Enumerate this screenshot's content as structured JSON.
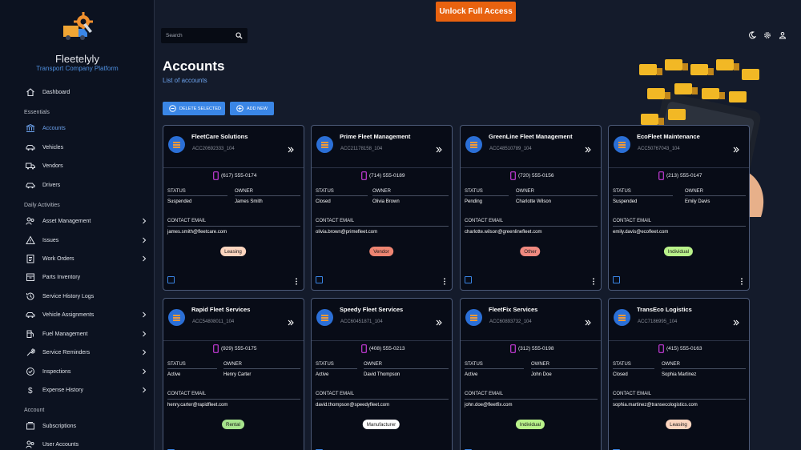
{
  "app": {
    "name": "Fleetelyly",
    "tagline": "Transport Company Platform"
  },
  "topbar": {
    "unlock_label": "Unlock Full Access",
    "search_placeholder": "Search"
  },
  "icons": {
    "theme": "moon-icon",
    "settings": "gear-icon",
    "profile": "person-icon"
  },
  "colors": {
    "accent": "#3a86e6",
    "unlock": "#e8620f",
    "sidebar_bg": "#0c1220",
    "page_bg": "#141b2b"
  },
  "sidebar": {
    "dashboard": "Dashboard",
    "sections": {
      "essentials": "Essentials",
      "daily": "Daily Activities",
      "account": "Account"
    },
    "essentials": [
      "Accounts",
      "Vehicles",
      "Vendors",
      "Drivers"
    ],
    "daily": [
      "Asset Management",
      "Issues",
      "Work Orders",
      "Parts Inventory",
      "Service History Logs",
      "Vehicle Assignments",
      "Fuel Management",
      "Service Reminders",
      "Inspections",
      "Expense History"
    ],
    "account": [
      "Subscriptions",
      "User Accounts"
    ],
    "active": "Accounts"
  },
  "page": {
    "title": "Accounts",
    "subtitle": "List of accounts",
    "delete_label": "DELETE SELECTED",
    "add_label": "ADD NEW"
  },
  "field_labels": {
    "status": "STATUS",
    "owner": "OWNER",
    "email": "CONTACT EMAIL"
  },
  "cards": [
    {
      "name": "FleetCare Solutions",
      "account": "ACC20692333_104",
      "phone": "(617) 555-0174",
      "status": "Suspended",
      "owner": "James Smith",
      "email": "james.smith@fleetcare.com",
      "type": "Leasing",
      "badge_color": "#fcd5bf"
    },
    {
      "name": "Prime Fleet Management",
      "account": "ACC21178158_104",
      "phone": "(714) 555-0189",
      "status": "Closed",
      "owner": "Olivia Brown",
      "email": "olivia.brown@primefleet.com",
      "type": "Vendor",
      "badge_color": "#ee8572"
    },
    {
      "name": "GreenLine Fleet Management",
      "account": "ACC48510789_104",
      "phone": "(720) 555-0156",
      "status": "Pending",
      "owner": "Charlotte Wilson",
      "email": "charlotte.wilson@greenlinefleet.com",
      "type": "Other",
      "badge_color": "#f08a80"
    },
    {
      "name": "EcoFleet Maintenance",
      "account": "ACC50767043_104",
      "phone": "(213) 555-0147",
      "status": "Suspended",
      "owner": "Emily Davis",
      "email": "emily.davis@ecofleet.com",
      "type": "Individual",
      "badge_color": "#b9f28a"
    },
    {
      "name": "Rapid Fleet Services",
      "account": "ACC54808011_104",
      "phone": "(929) 555-0175",
      "status": "Active",
      "owner": "Henry Carter",
      "email": "henry.carter@rapidfleet.com",
      "type": "Rental",
      "badge_color": "#a7e48d"
    },
    {
      "name": "Speedy Fleet Services",
      "account": "ACC60451871_104",
      "phone": "(408) 555-0213",
      "status": "Active",
      "owner": "David Thompson",
      "email": "david.thompson@speedyfleet.com",
      "type": "Manufacturer",
      "badge_color": "#ffffff"
    },
    {
      "name": "FleetFix Services",
      "account": "ACC60893732_104",
      "phone": "(312) 555-0198",
      "status": "Active",
      "owner": "John Doe",
      "email": "john.doe@fleetfix.com",
      "type": "Individual",
      "badge_color": "#b9f28a"
    },
    {
      "name": "TransEco Logistics",
      "account": "ACC7186995_104",
      "phone": "(415) 555-0163",
      "status": "Closed",
      "owner": "Sophia Martinez",
      "email": "sophia.martinez@transecologistics.com",
      "type": "Leasing",
      "badge_color": "#fcd5bf"
    }
  ]
}
